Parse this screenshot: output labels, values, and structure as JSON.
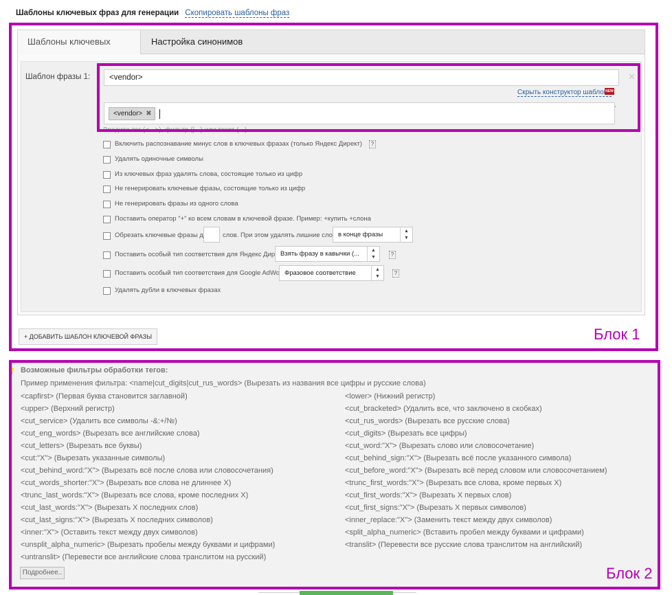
{
  "header": {
    "title": "Шаблоны ключевых фраз для генерации",
    "copy_link": "Скопировать шаблоны фраз"
  },
  "tabs": [
    {
      "label": "Шаблоны ключевых фраз",
      "active": true
    },
    {
      "label": "Настройка синонимов",
      "active": false
    }
  ],
  "template": {
    "label": "Шаблон фразы 1:",
    "value": "<vendor>",
    "constructor_link": "Скрыть конструктор шаблона",
    "new_badge": "NEW",
    "tag": "<vendor>",
    "hint": "Введите тег (<...>), фильтр (|...) или текст (...)"
  },
  "options": [
    {
      "label": "Включить распознавание минус слов в ключевых фразах (только Яндекс Директ)",
      "help": "?"
    },
    {
      "label": "Удалять одиночные символы"
    },
    {
      "label": "Из ключевых фраз удалять слова, состоящие только из цифр"
    },
    {
      "label": "Не генерировать ключевые фразы, состоящие только из цифр"
    },
    {
      "label": "Не генерировать фразы из одного слова"
    },
    {
      "label": "Поставить оператор \"+\" ко всем словам в ключевой фразе. Пример: +купить +слона"
    },
    {
      "label": "Обрезать ключевые фразы до",
      "suffix": "слов. При этом удалять лишние слова",
      "select": "в конце фразы"
    },
    {
      "label": "Поставить особый тип соответствия для Яндекс Директ",
      "select": "Взять фразу в кавычки (...",
      "help": "?"
    },
    {
      "label": "Поставить особый тип соответствия для Google AdWords",
      "select": "Фразовое соответствие",
      "help": "?"
    },
    {
      "label": "Удалять дубли в ключевых фразах"
    }
  ],
  "add_button": "+ ДОБАВИТЬ ШАБЛОН КЛЮЧЕВОЙ ФРАЗЫ",
  "markers": {
    "block1": "Блок 1",
    "block2": "Блок 2"
  },
  "filters": {
    "title": "Возможные фильтры обработки тегов:",
    "example": "Пример применения фильтра: <name|cut_digits|cut_rus_words> (Вырезать из названия все цифры и русские слова)",
    "left": [
      "<capfirst> (Первая буква становится заглавной)",
      "<upper> (Верхний регистр)",
      "<cut_service> (Удалить все символы -&:+/№)",
      "<cut_eng_words> (Вырезать все английские слова)",
      "<cut_letters> (Вырезать все буквы)",
      "<cut:\"X\"> (Вырезать указанные символы)",
      "<cut_behind_word:\"X\"> (Вырезать всё после слова или словосочетания)",
      "<cut_words_shorter:\"X\"> (Вырезать все слова не длиннее X)",
      "<trunc_last_words:\"X\"> (Вырезать все слова, кроме последних X)",
      "<cut_last_words:\"X\"> (Вырезать X последних слов)",
      "<cut_last_signs:\"X\"> (Вырезать X последних символов)",
      "<inner:\"X\"> (Оставить текст между двух символов)",
      "<unsplit_alpha_numeric> (Вырезать пробелы между буквами и цифрами)",
      "<untranslit> (Перевести все английские слова транслитом на русский)"
    ],
    "right": [
      "<lower> (Нижний регистр)",
      "<cut_bracketed> (Удалить все, что заключено в скобках)",
      "<cut_rus_words> (Вырезать все русские слова)",
      "<cut_digits> (Вырезать все цифры)",
      "<cut_word:\"X\"> (Вырезать слово или словосочетание)",
      "<cut_behind_sign:\"X\"> (Вырезать всё после указанного символа)",
      "<cut_before_word:\"X\"> (Вырезать всё перед словом или словосочетанием)",
      "<trunc_first_words:\"X\"> (Вырезать все слова, кроме первых X)",
      "<cut_first_words:\"X\"> (Вырезать X первых слов)",
      "<cut_first_signs:\"X\"> (Вырезать X первых символов)",
      "<inner_replace:\"X\"> (Заменить текст между двух символов)",
      "<split_alpha_numeric> (Вставить пробел между буквами и цифрами)",
      "<translit> (Перевести все русские слова транслитом на английский)"
    ],
    "more_button": "Подробнее.."
  }
}
